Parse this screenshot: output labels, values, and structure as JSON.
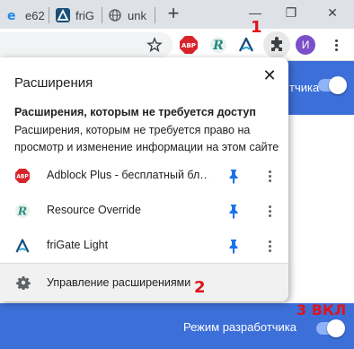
{
  "tabs": [
    {
      "label": "e62",
      "icon": "ie-icon"
    },
    {
      "label": "friG",
      "icon": "frigate-icon"
    },
    {
      "label": "unk",
      "icon": "globe-icon"
    }
  ],
  "window_controls": {
    "minimize": "—",
    "maximize": "❐",
    "close": "✕"
  },
  "toolbar": {
    "abp_label": "ABP",
    "avatar_initial": "И"
  },
  "annotations": {
    "mark1": "1",
    "mark2": "2",
    "mark3": "3 ВКЛ"
  },
  "background_page": {
    "header_text_fragment": "тчика",
    "dev_mode_label": "Режим разработчика",
    "dev_mode_on": true
  },
  "popup": {
    "title": "Расширения",
    "close_label": "✕",
    "section_heading": "Расширения, которым не требуется доступ",
    "section_desc": "Расширения, которым не требуется право на просмотр и изменение информации на этом сайте",
    "extensions": [
      {
        "name": "Adblock Plus - бесплатный бл…",
        "icon": "abp-icon",
        "pinned": true
      },
      {
        "name": "Resource Override",
        "icon": "resource-override-icon",
        "pinned": true
      },
      {
        "name": "friGate Light",
        "icon": "frigate-icon",
        "pinned": true
      }
    ],
    "manage_label": "Управление расширениями"
  },
  "colors": {
    "accent_blue": "#3c6fd8",
    "pin_blue": "#1a73e8",
    "annotation_red": "#e0131b"
  }
}
